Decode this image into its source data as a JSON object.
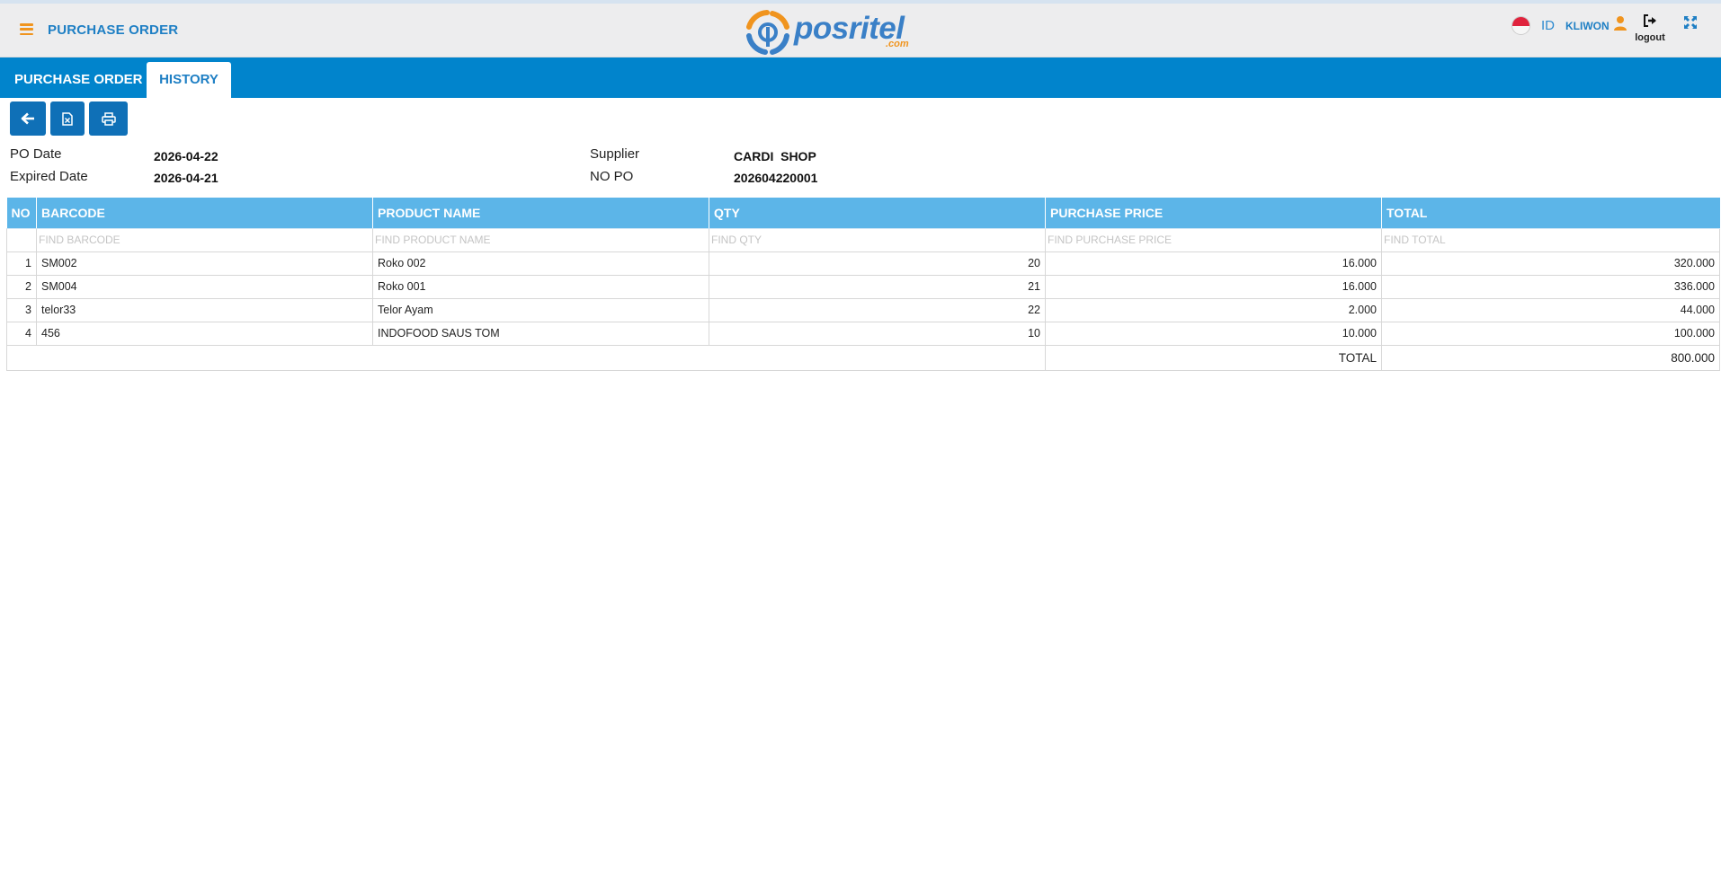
{
  "header": {
    "title": "PURCHASE ORDER",
    "logo_text": "posritel",
    "logo_suffix": ".com",
    "language": "ID",
    "username": "KLIWON",
    "logout_label": "logout"
  },
  "tabs": [
    {
      "label": "PURCHASE ORDER",
      "active": false
    },
    {
      "label": "HISTORY",
      "active": true
    }
  ],
  "toolbar": {
    "buttons": [
      "back-arrow-icon",
      "excel-export-icon",
      "print-icon"
    ]
  },
  "info": {
    "po_date_label": "PO Date",
    "po_date": "2026-04-22",
    "expired_date_label": "Expired Date",
    "expired_date": "2026-04-21",
    "supplier_label": "Supplier",
    "supplier": "CARDI  SHOP",
    "no_po_label": "NO PO",
    "no_po": "202604220001"
  },
  "table": {
    "headers": [
      "NO",
      "BARCODE",
      "PRODUCT NAME",
      "QTY",
      "PURCHASE PRICE",
      "TOTAL"
    ],
    "filters": [
      "FIND BARCODE",
      "FIND PRODUCT NAME",
      "FIND QTY",
      "FIND PURCHASE PRICE",
      "FIND TOTAL"
    ],
    "rows": [
      {
        "no": "1",
        "barcode": "SM002",
        "product": "Roko 002",
        "qty": "20",
        "price": "16.000",
        "total": "320.000"
      },
      {
        "no": "2",
        "barcode": "SM004",
        "product": "Roko 001",
        "qty": "21",
        "price": "16.000",
        "total": "336.000"
      },
      {
        "no": "3",
        "barcode": "telor33",
        "product": "Telor Ayam",
        "qty": "22",
        "price": "2.000",
        "total": "44.000"
      },
      {
        "no": "4",
        "barcode": "456",
        "product": "INDOFOOD SAUS TOM",
        "qty": "10",
        "price": "10.000",
        "total": "100.000"
      }
    ],
    "total_label": "TOTAL",
    "total_value": "800.000"
  },
  "colors": {
    "brand_blue": "#0184cc",
    "header_bg": "#ededee",
    "accent_orange": "#f0941e",
    "table_header": "#5cb5e8",
    "button_blue": "#0f70b7"
  }
}
